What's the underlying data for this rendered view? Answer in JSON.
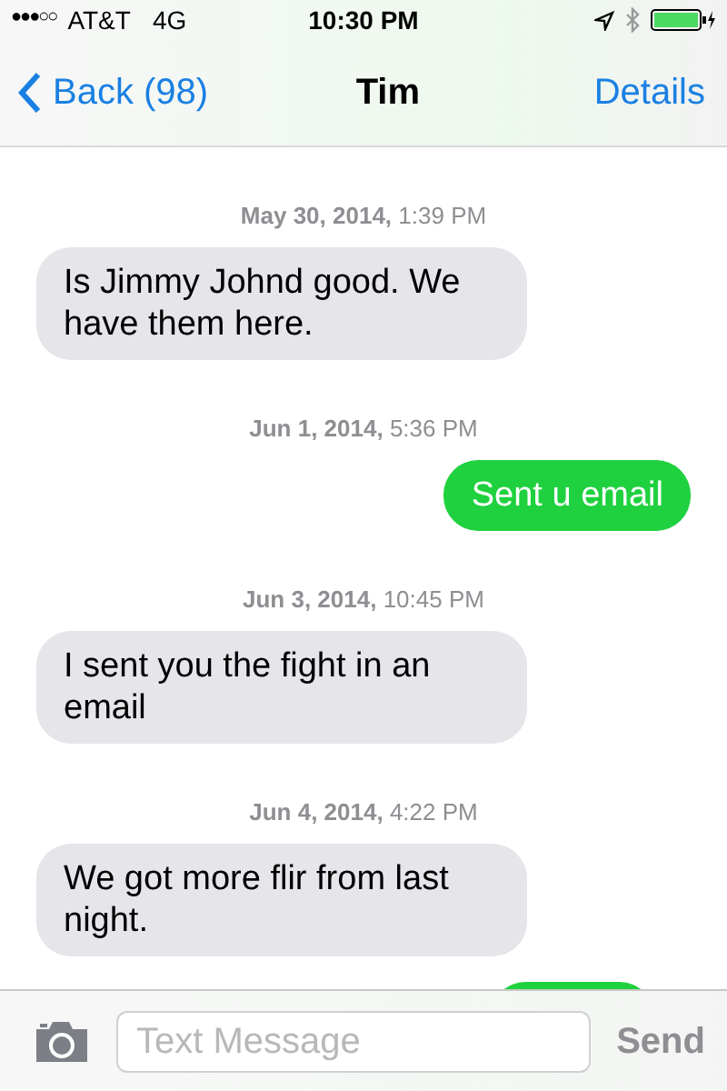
{
  "status_bar": {
    "signal": "●●●○○",
    "carrier": "AT&T",
    "network": "4G",
    "time": "10:30 PM"
  },
  "nav": {
    "back": "Back (98)",
    "title": "Tim",
    "action": "Details"
  },
  "messages": [
    {
      "kind": "date",
      "text": "**May 30, 2014,** 1:39 PM"
    },
    {
      "kind": "received",
      "text": "Is Jimmy Johnd good. We have them here."
    },
    {
      "kind": "date",
      "text": "**Jun 1, 2014,** 5:36 PM"
    },
    {
      "kind": "sent",
      "text": "Sent u email"
    },
    {
      "kind": "date",
      "text": "**Jun 3, 2014,** 10:45 PM"
    },
    {
      "kind": "received",
      "text": "I sent you the fight in an email"
    },
    {
      "kind": "date",
      "text": "**Jun 4, 2014,** 4:22 PM"
    },
    {
      "kind": "received",
      "text": "We got more flir from last night."
    },
    {
      "kind": "sent"
    }
  ],
  "input": {
    "placeholder": "Text Message",
    "send": "Send"
  }
}
